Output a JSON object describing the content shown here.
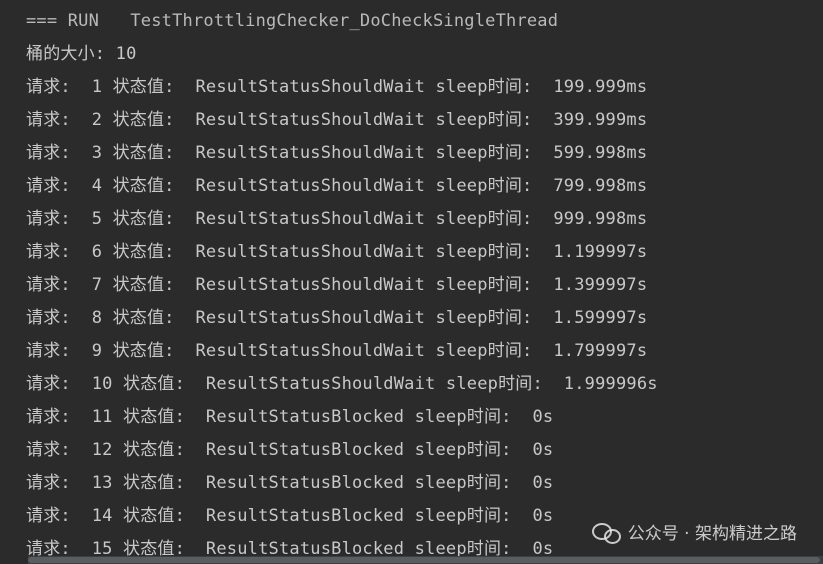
{
  "console": {
    "run_line": "=== RUN   TestThrottlingChecker_DoCheckSingleThread",
    "bucket_line": "桶的大小: 10",
    "requests": [
      {
        "text": "请求:  1 状态值:  ResultStatusShouldWait sleep时间:  199.999ms"
      },
      {
        "text": "请求:  2 状态值:  ResultStatusShouldWait sleep时间:  399.999ms"
      },
      {
        "text": "请求:  3 状态值:  ResultStatusShouldWait sleep时间:  599.998ms"
      },
      {
        "text": "请求:  4 状态值:  ResultStatusShouldWait sleep时间:  799.998ms"
      },
      {
        "text": "请求:  5 状态值:  ResultStatusShouldWait sleep时间:  999.998ms"
      },
      {
        "text": "请求:  6 状态值:  ResultStatusShouldWait sleep时间:  1.199997s"
      },
      {
        "text": "请求:  7 状态值:  ResultStatusShouldWait sleep时间:  1.399997s"
      },
      {
        "text": "请求:  8 状态值:  ResultStatusShouldWait sleep时间:  1.599997s"
      },
      {
        "text": "请求:  9 状态值:  ResultStatusShouldWait sleep时间:  1.799997s"
      },
      {
        "text": "请求:  10 状态值:  ResultStatusShouldWait sleep时间:  1.999996s"
      },
      {
        "text": "请求:  11 状态值:  ResultStatusBlocked sleep时间:  0s"
      },
      {
        "text": "请求:  12 状态值:  ResultStatusBlocked sleep时间:  0s"
      },
      {
        "text": "请求:  13 状态值:  ResultStatusBlocked sleep时间:  0s"
      },
      {
        "text": "请求:  14 状态值:  ResultStatusBlocked sleep时间:  0s"
      },
      {
        "text": "请求:  15 状态值:  ResultStatusBlocked sleep时间:  0s"
      }
    ]
  },
  "watermark": {
    "icon": "wechat-icon",
    "text": "公众号 · 架构精进之路"
  },
  "colors": {
    "background": "#2b2b2b",
    "text": "#c8c8c8"
  }
}
